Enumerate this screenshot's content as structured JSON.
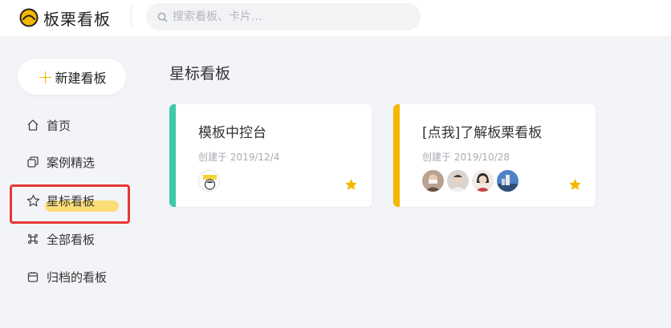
{
  "brand": {
    "name": "板栗看板"
  },
  "search": {
    "placeholder": "搜索看板、卡片..."
  },
  "new_board": {
    "icon": "plus-icon",
    "label": "新建看板"
  },
  "nav": {
    "items": [
      {
        "id": "home",
        "icon": "home-icon",
        "label": "首页"
      },
      {
        "id": "cases",
        "icon": "copy-icon",
        "label": "案例精选"
      },
      {
        "id": "starred",
        "icon": "star-outline-icon",
        "label": "星标看板",
        "active": true
      },
      {
        "id": "all",
        "icon": "command-icon",
        "label": "全部看板"
      },
      {
        "id": "archived",
        "icon": "archive-icon",
        "label": "归档的看板"
      }
    ]
  },
  "main": {
    "section_title": "星标看板",
    "cards": [
      {
        "title": "模板中控台",
        "date": "创建于 2019/12/4",
        "accent_color": "#3ec9a7",
        "starred": true,
        "member_count": 1
      },
      {
        "title": "[点我]了解板栗看板",
        "date": "创建于 2019/10/28",
        "accent_color": "#f5b700",
        "starred": true,
        "member_count": 4
      }
    ]
  },
  "colors": {
    "brand_yellow": "#f5b700",
    "highlight_yellow": "#fbd860",
    "annotation_red": "#e53935",
    "teal_accent": "#3ec9a7",
    "background": "#f3f4f8"
  }
}
